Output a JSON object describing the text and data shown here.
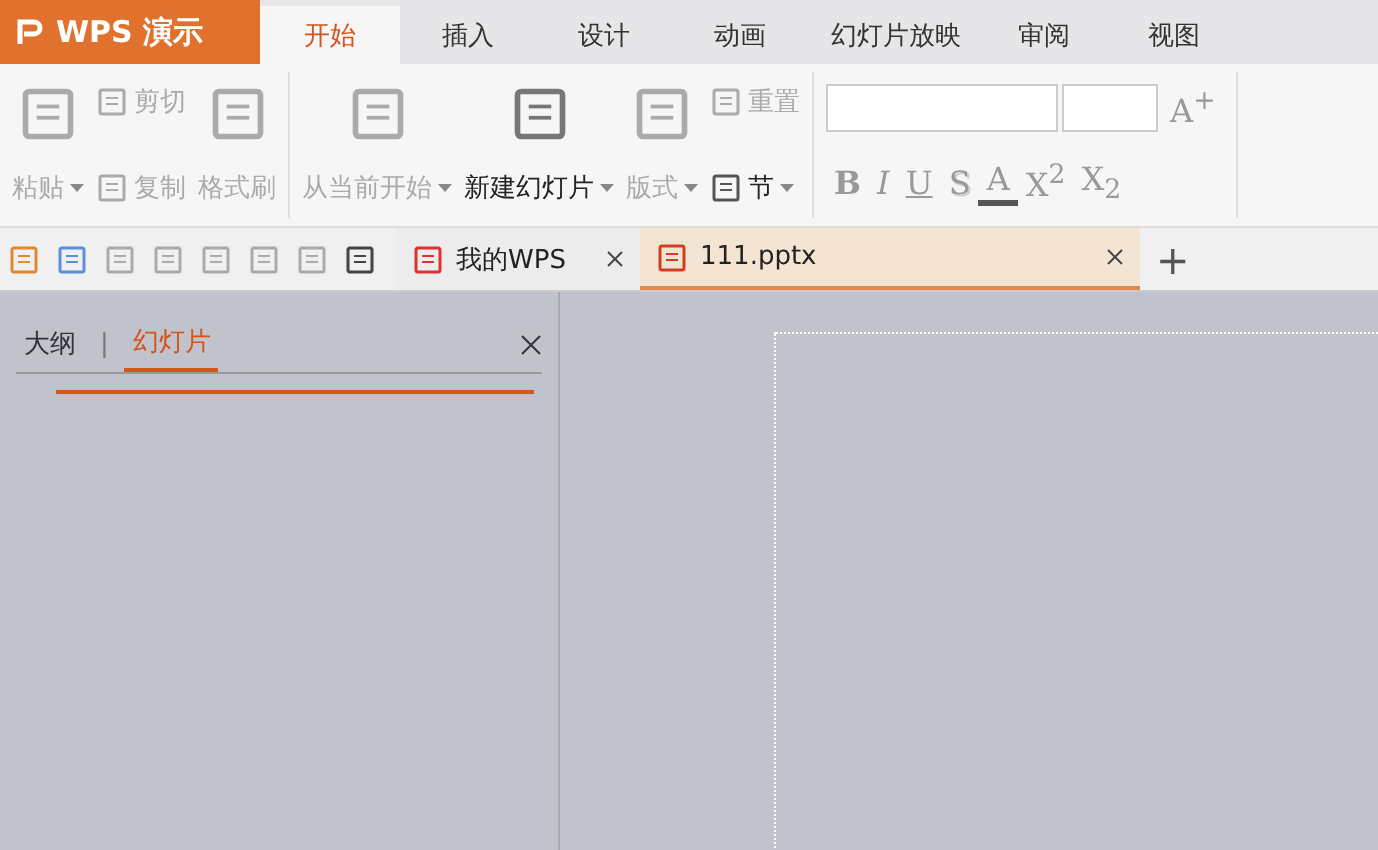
{
  "app_menu": {
    "label": "WPS 演示"
  },
  "tabs": [
    {
      "label": "开始",
      "selected": true
    },
    {
      "label": "插入",
      "selected": false
    },
    {
      "label": "设计",
      "selected": false
    },
    {
      "label": "动画",
      "selected": false
    },
    {
      "label": "幻灯片放映",
      "selected": false
    },
    {
      "label": "审阅",
      "selected": false
    },
    {
      "label": "视图",
      "selected": false
    }
  ],
  "ribbon": {
    "paste": "粘贴",
    "cut": "剪切",
    "copy": "复制",
    "format_painter": "格式刷",
    "play_from_current": "从当前开始",
    "new_slide": "新建幻灯片",
    "layout": "版式",
    "reset": "重置",
    "section": "节",
    "format_buttons": [
      {
        "label": "B",
        "kind": "bold"
      },
      {
        "label": "I",
        "kind": "italic"
      },
      {
        "label": "U",
        "kind": "underline"
      },
      {
        "label": "S",
        "kind": "shadow"
      },
      {
        "label": "A",
        "kind": "color"
      },
      {
        "label": "X$^{2}$",
        "kind": "plain"
      },
      {
        "label": "X$_{2}$",
        "kind": "plain"
      }
    ],
    "grow_font": "A$^{+}$"
  },
  "doc_tabs": [
    {
      "label": "我的WPS",
      "selected": false,
      "kind": "home"
    },
    {
      "label": "111.pptx",
      "selected": true,
      "kind": "file"
    }
  ],
  "new_tab": "+",
  "sidebar": {
    "tabs": [
      {
        "label": "大纲",
        "selected": false
      },
      {
        "label": "幻灯片",
        "selected": true
      }
    ],
    "separator": "|"
  }
}
